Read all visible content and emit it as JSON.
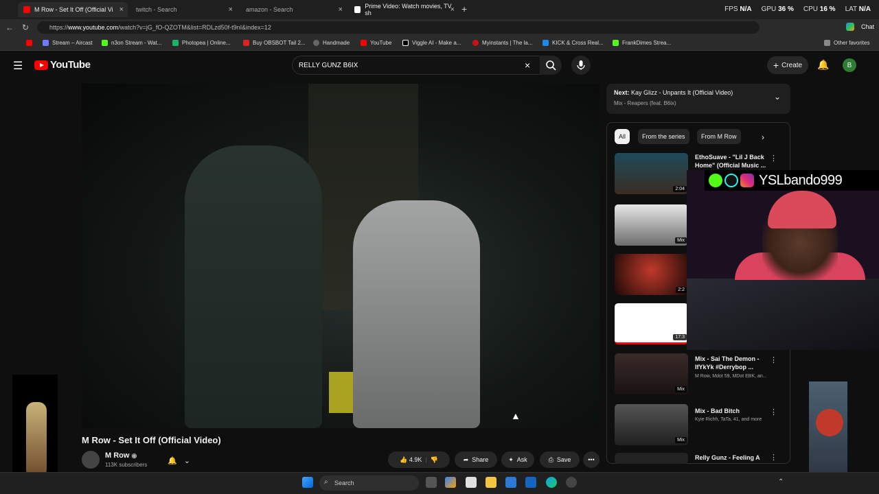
{
  "browser": {
    "tabs": [
      {
        "label": "M Row - Set It Off (Official Vi"
      },
      {
        "label": "twitch - Search"
      },
      {
        "label": "amazon - Search"
      },
      {
        "label": "Prime Video: Watch movies, TV sh"
      }
    ],
    "url_prefix": "https://",
    "url_host": "www.youtube.com",
    "url_path": "/watch?v=jG_fO-QZOTM&list=RDLzd50f-t9nI&index=12",
    "chat_label": "Chat",
    "bookmarks": [
      "Stream – Aircast",
      "n3on Stream - Wat...",
      "Photopea | Online...",
      "Buy OBSBOT Tail 2...",
      "Handmade",
      "YouTube",
      "Viggle AI - Make a...",
      "Myinstants | The la...",
      "KICK & Cross Real...",
      "FrankDimes Strea...",
      "Other favorites"
    ]
  },
  "system": {
    "fps_label": "FPS",
    "fps_value": "N/A",
    "gpu_label": "GPU",
    "gpu_value": "36 %",
    "cpu_label": "CPU",
    "cpu_value": "16 %",
    "lat_label": "LAT",
    "lat_value": "N/A"
  },
  "youtube": {
    "logo_text": "YouTube",
    "search_value": "RELLY GUNZ B6IX",
    "create_label": "Create",
    "avatar_letter": "B"
  },
  "video": {
    "title": "M Row - Set It Off (Official Video)",
    "channel": "M Row",
    "subscribers": "113K subscribers",
    "likes": "4.9K",
    "share": "Share",
    "ask": "Ask",
    "save": "Save"
  },
  "next_up": {
    "prefix": "Next:",
    "title": "Kay Glizz - Unpants It (Official Video)",
    "subtitle": "Mix - Reapers (feat. B6ix)"
  },
  "chips": [
    "All",
    "From the series",
    "From M Row"
  ],
  "playlist": [
    {
      "title": "EthoSuave - \"Lil J Back Home\" (Official Music ...",
      "sub": "",
      "duration": "2:04"
    },
    {
      "title": "",
      "sub": "",
      "duration": "Mix"
    },
    {
      "title": "",
      "sub": "",
      "duration": "2:2"
    },
    {
      "title": "",
      "sub": "",
      "duration": "17:3"
    },
    {
      "title": "Mix - Sai The Demon - IfYkYk #Derrybop ...",
      "sub": "M Row, Mdot 59, MDot EBK, an...",
      "duration": "Mix"
    },
    {
      "title": "Mix - Bad Bitch",
      "sub": "Kyie Richh, TaTa, 41, and more",
      "duration": "Mix"
    },
    {
      "title": "Relly Gunz - Feeling A",
      "sub": "",
      "duration": ""
    }
  ],
  "overlay": {
    "handle": "YSLbando999"
  },
  "taskbar": {
    "search_placeholder": "Search"
  },
  "colors": {
    "accent": "#ff0000",
    "bg": "#0f0f0f",
    "chip_active": "#f1f1f1"
  }
}
